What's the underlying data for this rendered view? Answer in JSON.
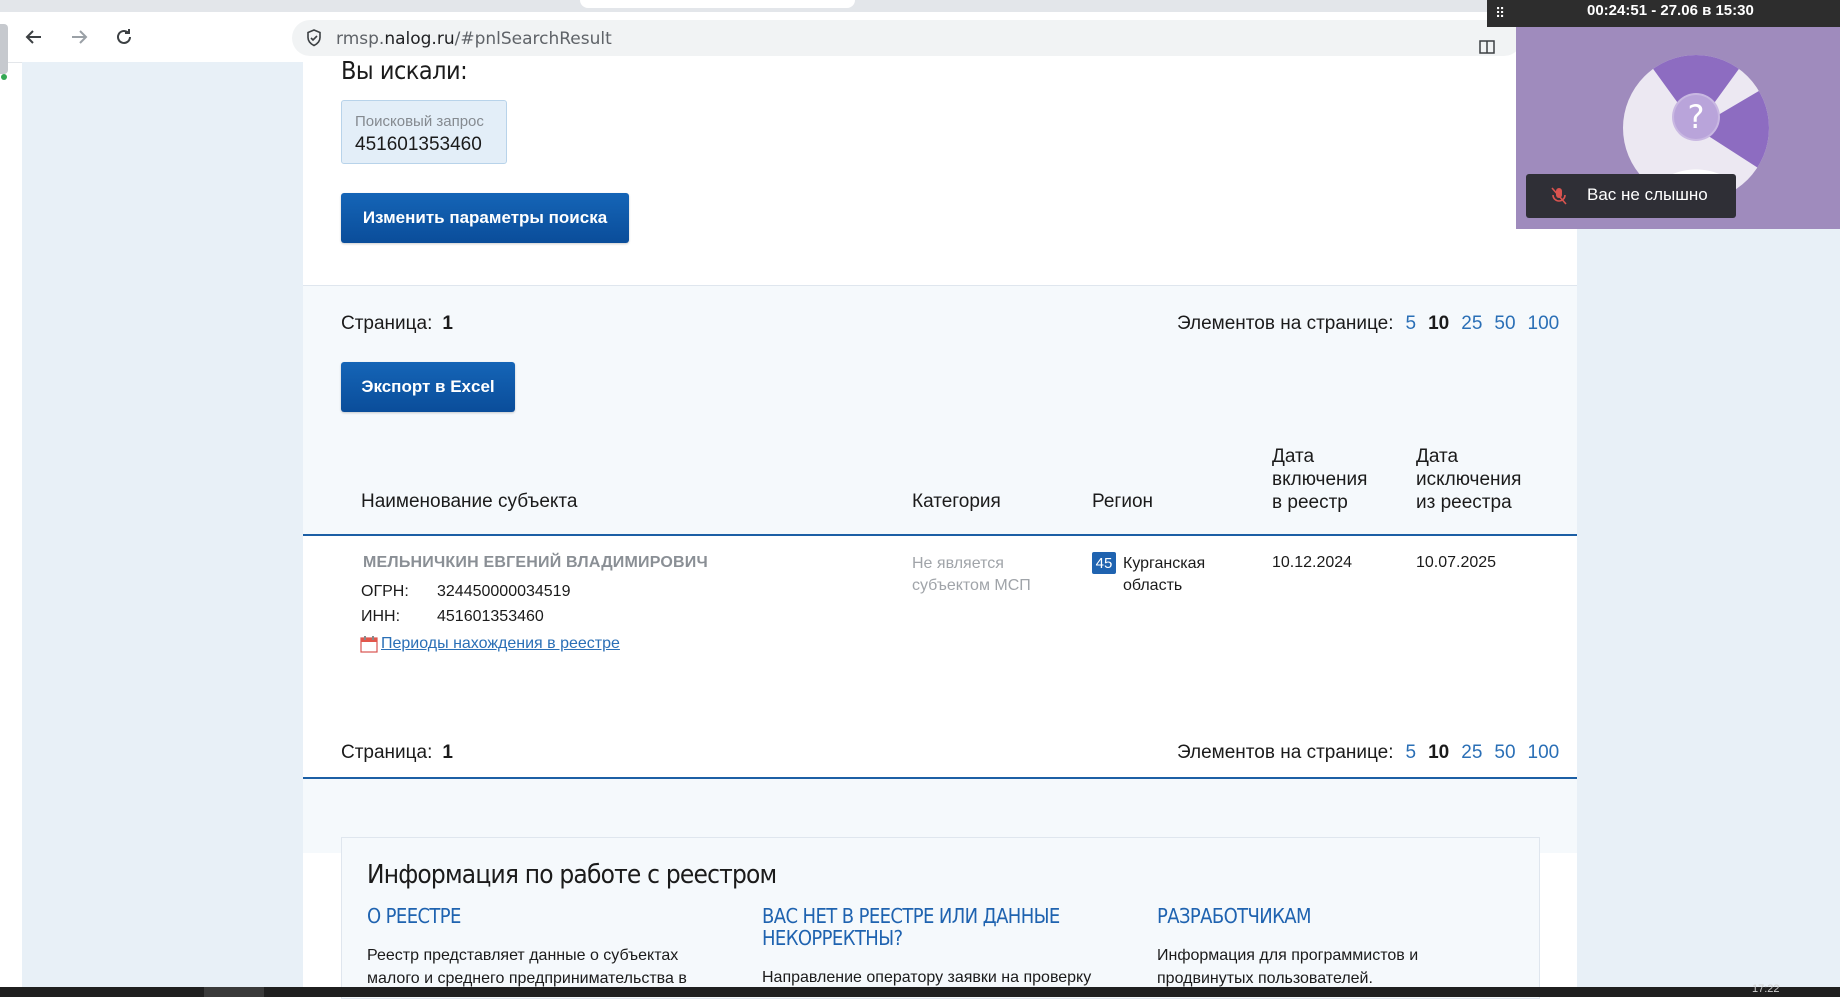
{
  "browser": {
    "url_prefix": "rmsp.",
    "url_domain": "nalog.ru",
    "url_path": "/#pnlSearchResult"
  },
  "search": {
    "heading": "Вы искали:",
    "query_label": "Поисковый запрос",
    "query_value": "451601353460",
    "change_button": "Изменить параметры поиска"
  },
  "pagination": {
    "page_label": "Страница:",
    "page_value": "1",
    "per_page_label": "Элементов на странице:",
    "options": [
      "5",
      "10",
      "25",
      "50",
      "100"
    ],
    "current": "10"
  },
  "export_button": "Экспорт в Excel",
  "table": {
    "headers": {
      "name": "Наименование субъекта",
      "category": "Категория",
      "region": "Регион",
      "incl_1": "Дата",
      "incl_2": "включения",
      "incl_3": "в реестр",
      "excl_1": "Дата",
      "excl_2": "исключения",
      "excl_3": "из реестра"
    },
    "row": {
      "name": "МЕЛЬНИЧКИН ЕВГЕНИЙ ВЛАДИМИРОВИЧ",
      "ogrn_label": "ОГРН:",
      "ogrn": "324450000034519",
      "inn_label": "ИНН:",
      "inn": "451601353460",
      "periods_link": "Периоды нахождения в реестре",
      "category_1": "Не является",
      "category_2": "субъектом МСП",
      "region_code": "45",
      "region_1": "Курганская",
      "region_2": "область",
      "date_included": "10.12.2024",
      "date_excluded": "10.07.2025"
    }
  },
  "info": {
    "title": "Информация по работе с реестром",
    "col1_h": "О РЕЕСТРЕ",
    "col1_t1": "Реестр представляет данные о субъектах",
    "col1_t2": "малого и среднего предпринимательства в",
    "col2_h1": "ВАС НЕТ В РЕЕСТРЕ ИЛИ ДАННЫЕ",
    "col2_h2": "НЕКОРРЕКТНЫ?",
    "col2_t1": "Направление оператору заявки на проверку",
    "col3_h": "РАЗРАБОТЧИКАМ",
    "col3_t1": "Информация для программистов и",
    "col3_t2": "продвинутых пользователей."
  },
  "meeting": {
    "timestamp": "00:24:51 - 27.06 в 15:30",
    "mute_text": "Вас не слышно",
    "avatar_mark": "?"
  },
  "taskbar": {
    "clock": "17:22"
  },
  "colors": {
    "accent": "#1c5fa5",
    "link": "#2a6fb6",
    "meeting_bg": "#9f8bbd"
  }
}
